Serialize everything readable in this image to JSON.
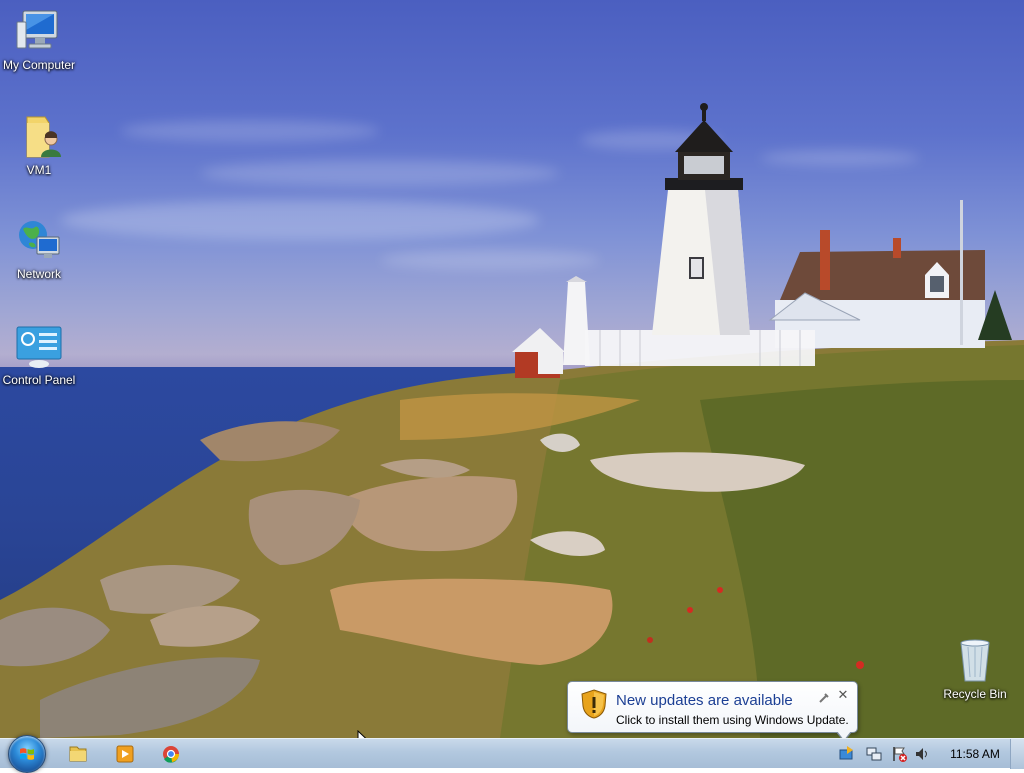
{
  "desktop": {
    "icons": [
      {
        "label": "My Computer"
      },
      {
        "label": "VM1"
      },
      {
        "label": "Network"
      },
      {
        "label": "Control Panel"
      },
      {
        "label": "Recycle Bin"
      }
    ]
  },
  "notification": {
    "title": "New updates are available",
    "body": "Click to install them using Windows Update.",
    "close_glyph": "✕"
  },
  "taskbar": {
    "start_button": "start-orb",
    "pinned": [
      "windows-explorer-icon",
      "media-player-icon",
      "chrome-icon"
    ],
    "tray_icons": [
      "windows-update-icon",
      "network-icon",
      "action-center-icon",
      "volume-icon"
    ],
    "clock": "11:58 AM"
  },
  "colors": {
    "taskbar": "#b2c8df",
    "balloon_title": "#1c3f94",
    "sky": "#5d72cc",
    "sea": "#2a4596"
  }
}
